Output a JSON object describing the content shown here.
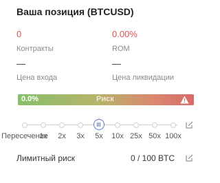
{
  "position": {
    "title": "Ваша позиция (BTCUSD)",
    "contracts_value": "0",
    "contracts_label": "Контракты",
    "rom_value": "0.00%",
    "rom_label": "ROM",
    "entry_price_value": "—",
    "entry_price_label": "Цена входа",
    "liquidation_price_value": "—",
    "liquidation_price_label": "Цена ликвидации"
  },
  "risk": {
    "percent": "0.0%",
    "label": "Риск"
  },
  "leverage": {
    "options": [
      "Пересечение",
      "1x",
      "2x",
      "3x",
      "5x",
      "10x",
      "25x",
      "50x",
      "100x"
    ],
    "selected": "5x"
  },
  "risk_limit": {
    "label": "Лимитный риск",
    "value": "0 / 100 BTC"
  },
  "colors": {
    "accent_red": "#d9534f",
    "slider_accent": "#5b78d6"
  }
}
